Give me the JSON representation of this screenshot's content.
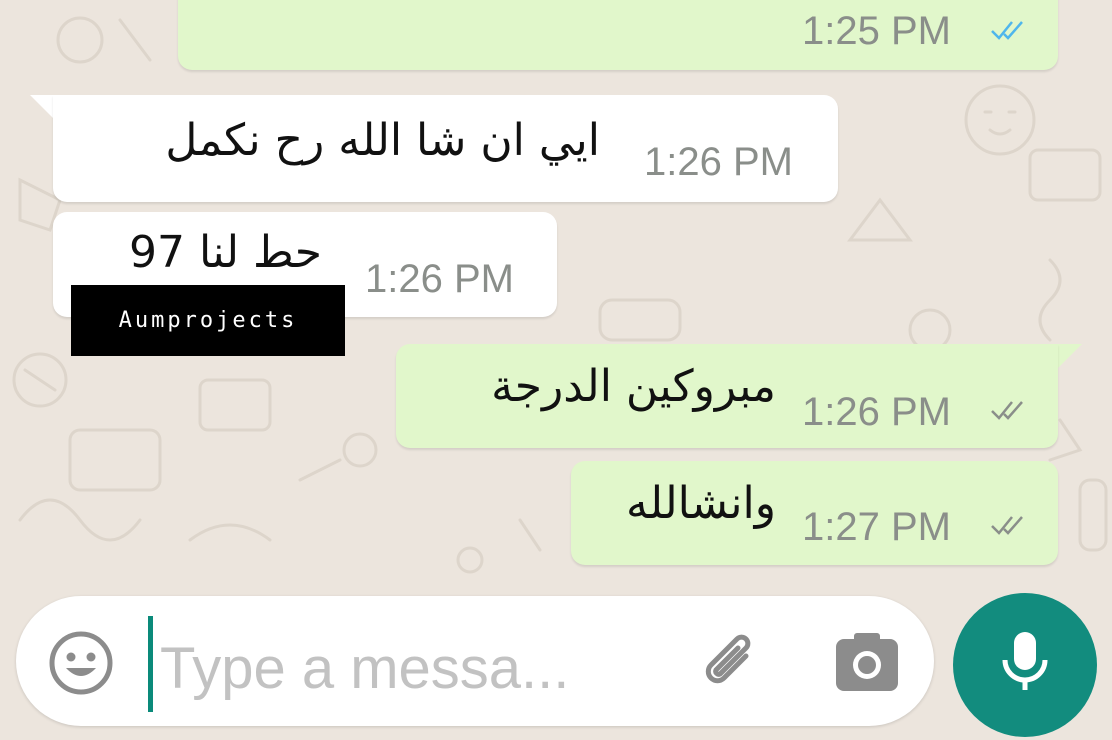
{
  "colors": {
    "background": "#ece5dd",
    "incoming_bubble": "#ffffff",
    "outgoing_bubble": "#e1f7cb",
    "read_ticks": "#4fb6ec",
    "sent_ticks": "#8a8e8a",
    "accent": "#128c7e"
  },
  "messages": [
    {
      "direction": "out",
      "text": "",
      "time": "1:25 PM",
      "status": "read"
    },
    {
      "direction": "in",
      "text": "ايي ان شا الله رح نكمل",
      "time": "1:26 PM"
    },
    {
      "direction": "in",
      "text": "حط لنا 97",
      "time": "1:26 PM"
    },
    {
      "direction": "out",
      "text": "مبروكين الدرجة",
      "time": "1:26 PM",
      "status": "delivered"
    },
    {
      "direction": "out",
      "text": "وانشالله",
      "time": "1:27 PM",
      "status": "delivered"
    }
  ],
  "watermark": "Aumprojects",
  "composer": {
    "placeholder": "Type a messa...",
    "emoji_icon": "smiley-icon",
    "attach_icon": "paperclip-icon",
    "camera_icon": "camera-icon",
    "mic_icon": "microphone-icon"
  }
}
